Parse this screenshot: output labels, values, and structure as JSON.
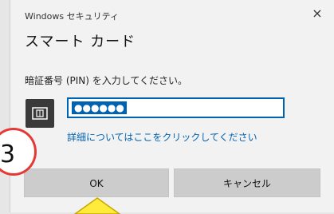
{
  "window": {
    "title": "Windows セキュリティ",
    "close_glyph": "×"
  },
  "dialog": {
    "heading": "スマート カード",
    "prompt": "暗証番号 (PIN) を入力してください。",
    "card_icon": "smart-card-icon",
    "pin_field": {
      "masked_value": "●●●●●●",
      "selected": true
    },
    "more_info_link": "詳細についてはここをクリックしてください"
  },
  "buttons": {
    "ok_label": "OK",
    "cancel_label": "キャンセル"
  },
  "annotation": {
    "step_number": "3",
    "circle_color": "#e53935",
    "arrow_color": "#ffeb3b"
  },
  "colors": {
    "accent": "#0063b1",
    "button_bg": "#cccccc",
    "dialog_bg": "#f2f2f2"
  }
}
